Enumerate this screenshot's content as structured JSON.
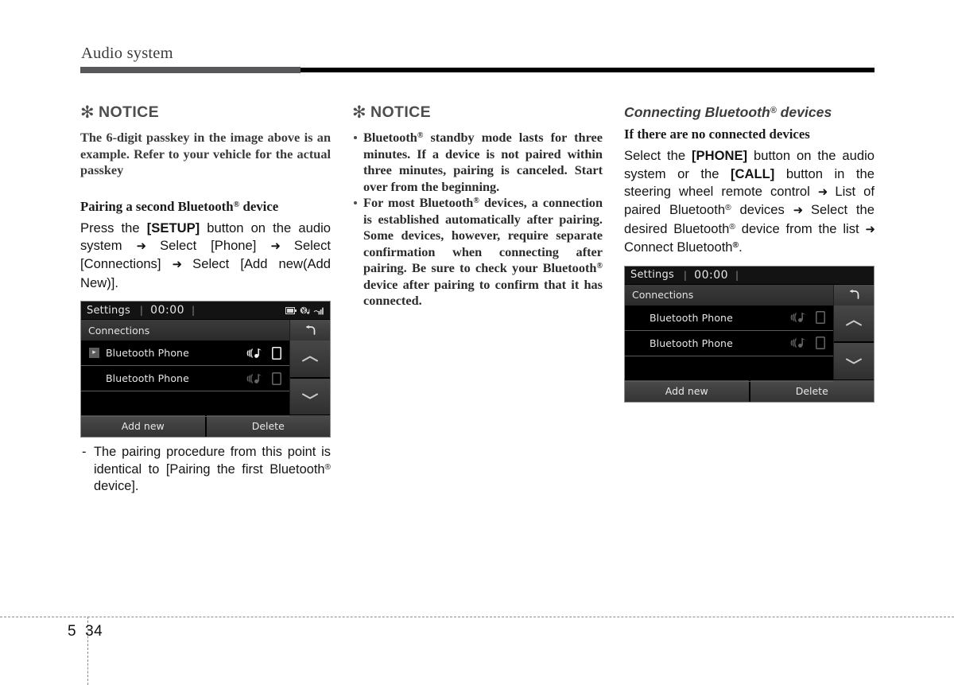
{
  "header": {
    "chapter_title": "Audio system"
  },
  "col1": {
    "notice_label": "NOTICE",
    "notice_asterisk": "asterisk-icon",
    "notice_text": "The 6-digit passkey in the image above is an example. Refer to your vehicle for the actual passkey",
    "sub_head_a": "Pairing a second Bluetooth",
    "sub_head_a_sup": "®",
    "sub_head_b": " device",
    "para_1": "Press the ",
    "para_1_b1": "[SETUP]",
    "para_2": " button on the audio system ",
    "arrow": "➜",
    "para_3": " Select [Phone] ",
    "para_4": " Select [Connections] ",
    "para_5": " Select [Add new(Add New)].",
    "note_1": "The pairing procedure from this point is identical to [Pairing the first Bluetooth",
    "note_1_sup": "®",
    "note_1_end": " device]."
  },
  "col2": {
    "notice_label": "NOTICE",
    "bullets": [
      {
        "a": "Bluetooth",
        "sup": "®",
        "b": " standby mode lasts for three minutes. If a device is not paired within three minutes, pairing is canceled. Start over from the beginning."
      },
      {
        "a": "For most Bluetooth",
        "sup": "®",
        "b": " devices, a connection is established automatically after pairing. Some devices, however, require separate confirmation when connecting after pairing. Be sure to check your Bluetooth",
        "sup2": "®",
        "c": " device after pairing to confirm that it has connected."
      }
    ]
  },
  "col3": {
    "section_head": "Connecting Bluetooth",
    "section_head_sup": "®",
    "section_head_end": " devices",
    "sub_head": "If there are no connected devices",
    "p_1": "Select the ",
    "p_b1": "[PHONE]",
    "p_2": " button on the audio system or the ",
    "p_b2": "[CALL]",
    "p_3": " button in the steering wheel remote control ",
    "arrow": "➜",
    "p_4": " List of paired Bluetooth",
    "p_4_sup": "®",
    "p_5": " devices ",
    "p_6": " Select the desired Bluetooth",
    "p_6_sup": "®",
    "p_7": " device from the list ",
    "p_8": " Connect Bluetooth",
    "p_8_sup": "®",
    "p_9": "."
  },
  "lcd1": {
    "status_title": "Settings",
    "status_sep": "|",
    "clock": "00:00",
    "status_sep2": "|",
    "icons": [
      "battery-icon",
      "bluetooth-audio-icon",
      "signal-icon"
    ],
    "subbar_label": "Connections",
    "back_icon": "↶",
    "rows": [
      {
        "marker": "▸",
        "label": "Bluetooth Phone",
        "connected": true
      },
      {
        "marker": "",
        "label": "Bluetooth Phone",
        "connected": false
      },
      {
        "marker": "",
        "label": "",
        "connected": false
      }
    ],
    "scroll_up": "⌃",
    "scroll_down": "⌄",
    "footer_buttons": [
      "Add new",
      "Delete"
    ]
  },
  "lcd2": {
    "status_title": "Settings",
    "status_sep": "|",
    "clock": "00:00",
    "status_sep2": "|",
    "icons": [],
    "subbar_label": "Connections",
    "back_icon": "↶",
    "rows": [
      {
        "marker": "",
        "label": "Bluetooth Phone",
        "connected": false
      },
      {
        "marker": "",
        "label": "Bluetooth Phone",
        "connected": false
      },
      {
        "marker": "",
        "label": "",
        "connected": false
      }
    ],
    "scroll_up": "⌃",
    "scroll_down": "⌄",
    "footer_buttons": [
      "Add new",
      "Delete"
    ]
  },
  "footer": {
    "chapter_number": "5",
    "page_number": "34"
  }
}
